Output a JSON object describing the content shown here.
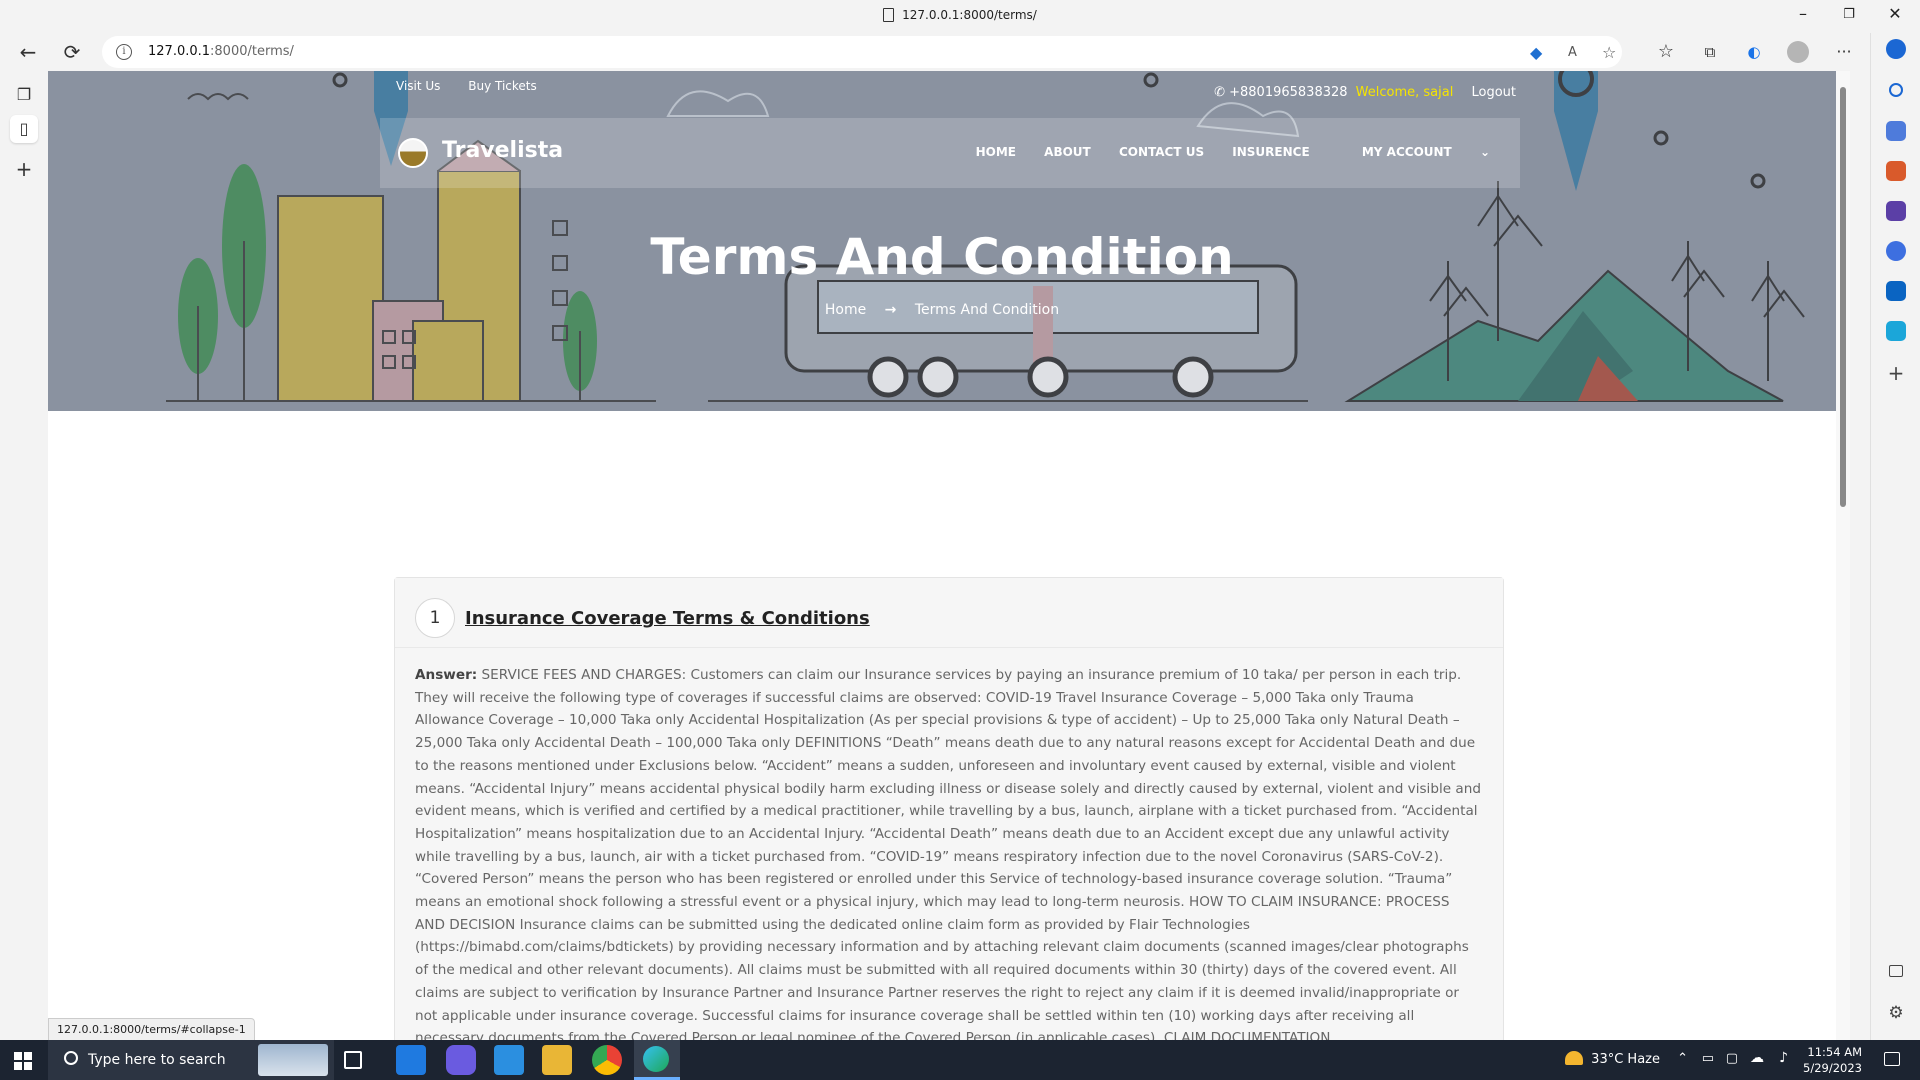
{
  "window": {
    "title": "127.0.0.1:8000/terms/",
    "minimize": "–",
    "restore": "❐",
    "close": "✕"
  },
  "toolbar": {
    "url_host": "127.0.0.1",
    "url_rest": ":8000/terms/",
    "back_icon": "←",
    "reload_icon": "⟳",
    "more_icon": "···"
  },
  "site": {
    "top_links": [
      "Visit Us",
      "Buy Tickets"
    ],
    "phone": "+8801965838328",
    "welcome": "Welcome, sajal",
    "logout": "Logout",
    "brand": "Travelista",
    "nav": [
      "HOME",
      "ABOUT",
      "CONTACT US",
      "INSURENCE",
      "MY ACCOUNT"
    ],
    "nav_caret": "⌄",
    "hero_title": "Terms And Condition",
    "breadcrumb": {
      "home": "Home",
      "arrow": "→",
      "current": "Terms And Condition"
    }
  },
  "accordion": {
    "number": "1",
    "title": "Insurance Coverage Terms & Conditions",
    "answer_label": "Answer:",
    "answer_text": " SERVICE FEES AND CHARGES: Customers can claim our Insurance services by paying an insurance premium of 10 taka/ per person in each trip. They will receive the following type of coverages if successful claims are observed: COVID-19 Travel Insurance Coverage – 5,000 Taka only Trauma Allowance Coverage – 10,000 Taka only Accidental Hospitalization (As per special provisions & type of accident) – Up to 25,000 Taka only Natural Death – 25,000 Taka only Accidental Death – 100,000 Taka only DEFINITIONS “Death” means death due to any natural reasons except for Accidental Death and due to the reasons mentioned under Exclusions below. “Accident” means a sudden, unforeseen and involuntary event caused by external, visible and violent means. “Accidental Injury” means accidental physical bodily harm excluding illness or disease solely and directly caused by external, violent and visible and evident means, which is verified and certified by a medical practitioner, while travelling by a bus, launch, airplane with a ticket purchased from. “Accidental Hospitalization” means hospitalization due to an Accidental Injury. “Accidental Death” means death due to an Accident except due any unlawful activity while travelling by a bus, launch, air with a ticket purchased from. “COVID-19” means respiratory infection due to the novel Coronavirus (SARS-CoV-2). “Covered Person” means the person who has been registered or enrolled under this Service of technology-based insurance coverage solution. “Trauma” means an emotional shock following a stressful event or a physical injury, which may lead to long-term neurosis. HOW TO CLAIM INSURANCE: PROCESS AND DECISION Insurance claims can be submitted using the dedicated online claim form as provided by Flair Technologies (https://bimabd.com/claims/bdtickets) by providing necessary information and by attaching relevant claim documents (scanned images/clear photographs of the medical and other relevant documents). All claims must be submitted with all required documents within 30 (thirty) days of the covered event. All claims are subject to verification by Insurance Partner and Insurance Partner reserves the right to reject any claim if it is deemed invalid/inappropriate or not applicable under insurance coverage. Successful claims for insurance coverage shall be settled within ten (10) working days after receiving all necessary documents from the Covered Person or legal nominee of the Covered Person (in applicable cases). CLAIM DOCUMENTATION"
  },
  "status_bar": "127.0.0.1:8000/terms/#collapse-1",
  "taskbar": {
    "search_placeholder": "Type here to search",
    "weather": "33°C  Haze",
    "time": "11:54 AM",
    "date": "5/29/2023"
  },
  "colors": {
    "welcome": "#f5e400",
    "hero_overlay": "#8f97a4"
  }
}
